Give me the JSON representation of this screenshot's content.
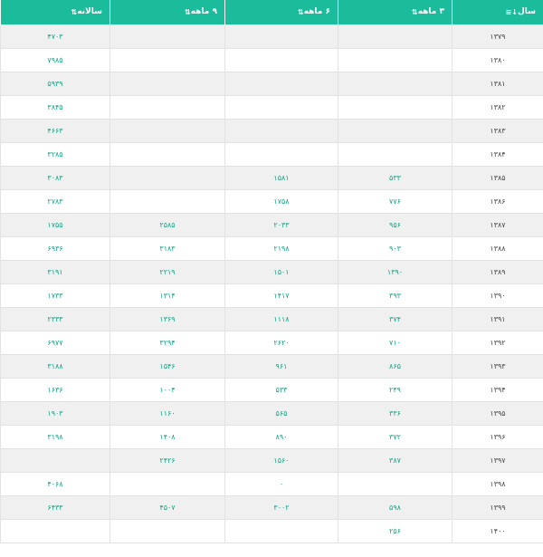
{
  "headers": [
    {
      "label": "سال",
      "icon": "sort-down-icon"
    },
    {
      "label": "۳ ماهه",
      "icon": "sort-icon"
    },
    {
      "label": "۶ ماهه",
      "icon": "sort-icon"
    },
    {
      "label": "۹ ماهه",
      "icon": "sort-icon"
    },
    {
      "label": "سالانه",
      "icon": "sort-icon"
    }
  ],
  "rows": [
    {
      "year": "۱۳۷۹",
      "m3": "",
      "m6": "",
      "m9": "",
      "annual": "۴۷۰۳"
    },
    {
      "year": "۱۳۸۰",
      "m3": "",
      "m6": "",
      "m9": "",
      "annual": "۷۹۸۵"
    },
    {
      "year": "۱۳۸۱",
      "m3": "",
      "m6": "",
      "m9": "",
      "annual": "۵۹۳۹"
    },
    {
      "year": "۱۳۸۲",
      "m3": "",
      "m6": "",
      "m9": "",
      "annual": "۳۸۴۵"
    },
    {
      "year": "۱۳۸۳",
      "m3": "",
      "m6": "",
      "m9": "",
      "annual": "۴۶۶۳"
    },
    {
      "year": "۱۳۸۴",
      "m3": "",
      "m6": "",
      "m9": "",
      "annual": "۳۲۸۵"
    },
    {
      "year": "۱۳۸۵",
      "m3": "۵۳۳",
      "m6": "۱۵۸۱",
      "m9": "",
      "annual": "۳۰۸۳"
    },
    {
      "year": "۱۳۸۶",
      "m3": "۷۷۶",
      "m6": "۱۷۵۸",
      "m9": "",
      "annual": "۲۷۸۳"
    },
    {
      "year": "۱۳۸۷",
      "m3": "۹۵۶",
      "m6": "۲۰۳۳",
      "m9": "۲۵۸۵",
      "annual": "۱۷۵۵"
    },
    {
      "year": "۱۳۸۸",
      "m3": "۹۰۳",
      "m6": "۲۱۹۸",
      "m9": "۳۱۸۳",
      "annual": "۶۹۳۶"
    },
    {
      "year": "۱۳۸۹",
      "m3": "۱۳۹۰",
      "m6": "۱۵۰۱",
      "m9": "۲۲۱۹",
      "annual": "۳۱۹۱"
    },
    {
      "year": "۱۳۹۰",
      "m3": "۳۹۳",
      "m6": "۱۴۱۷",
      "m9": "۱۳۱۴",
      "annual": "۱۷۳۳"
    },
    {
      "year": "۱۳۹۱",
      "m3": "۳۷۴",
      "m6": "۱۱۱۸",
      "m9": "۱۳۶۹",
      "annual": "۲۳۳۳"
    },
    {
      "year": "۱۳۹۲",
      "m3": "۷۱۰",
      "m6": "۲۶۲۰",
      "m9": "۳۲۹۴",
      "annual": "۶۹۷۷"
    },
    {
      "year": "۱۳۹۳",
      "m3": "۸۶۵",
      "m6": "۹۶۱",
      "m9": "۱۵۴۶",
      "annual": "۳۱۸۸"
    },
    {
      "year": "۱۳۹۴",
      "m3": "۲۴۹",
      "m6": "۵۳۳",
      "m9": "۱۰۰۴",
      "annual": "۱۶۳۶"
    },
    {
      "year": "۱۳۹۵",
      "m3": "۳۳۶",
      "m6": "۵۶۵",
      "m9": "۱۱۶۰",
      "annual": "۱۹۰۳"
    },
    {
      "year": "۱۳۹۶",
      "m3": "۳۷۲",
      "m6": "۸۹۰",
      "m9": "۱۴۰۸",
      "annual": "۳۱۹۸"
    },
    {
      "year": "۱۳۹۷",
      "m3": "۳۸۷",
      "m6": "۱۵۶۰",
      "m9": "۲۴۲۶",
      "annual": ""
    },
    {
      "year": "۱۳۹۸",
      "m3": "",
      "m6": "۰",
      "m9": "",
      "annual": "۴۰۶۸"
    },
    {
      "year": "۱۳۹۹",
      "m3": "۵۹۸",
      "m6": "۳۰۰۲",
      "m9": "۴۵۰۷",
      "annual": "۶۴۳۳"
    },
    {
      "year": "۱۴۰۰",
      "m3": "۲۵۶",
      "m6": "",
      "m9": "",
      "annual": ""
    }
  ]
}
